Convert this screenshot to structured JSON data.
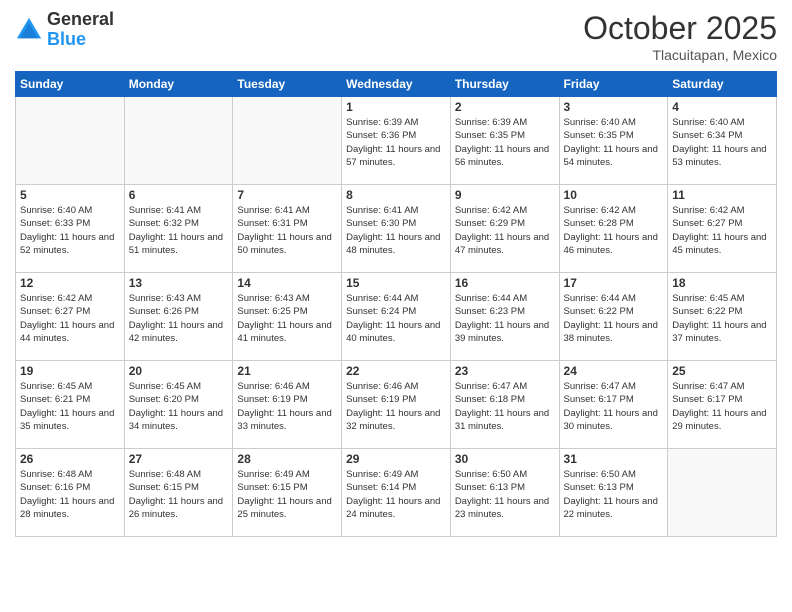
{
  "header": {
    "logo_line1": "General",
    "logo_line2": "Blue",
    "month": "October 2025",
    "location": "Tlacuitapan, Mexico"
  },
  "days_of_week": [
    "Sunday",
    "Monday",
    "Tuesday",
    "Wednesday",
    "Thursday",
    "Friday",
    "Saturday"
  ],
  "weeks": [
    [
      {
        "day": "",
        "empty": true
      },
      {
        "day": "",
        "empty": true
      },
      {
        "day": "",
        "empty": true
      },
      {
        "day": "1",
        "sunrise": "6:39 AM",
        "sunset": "6:36 PM",
        "daylight": "11 hours and 57 minutes."
      },
      {
        "day": "2",
        "sunrise": "6:39 AM",
        "sunset": "6:35 PM",
        "daylight": "11 hours and 56 minutes."
      },
      {
        "day": "3",
        "sunrise": "6:40 AM",
        "sunset": "6:35 PM",
        "daylight": "11 hours and 54 minutes."
      },
      {
        "day": "4",
        "sunrise": "6:40 AM",
        "sunset": "6:34 PM",
        "daylight": "11 hours and 53 minutes."
      }
    ],
    [
      {
        "day": "5",
        "sunrise": "6:40 AM",
        "sunset": "6:33 PM",
        "daylight": "11 hours and 52 minutes."
      },
      {
        "day": "6",
        "sunrise": "6:41 AM",
        "sunset": "6:32 PM",
        "daylight": "11 hours and 51 minutes."
      },
      {
        "day": "7",
        "sunrise": "6:41 AM",
        "sunset": "6:31 PM",
        "daylight": "11 hours and 50 minutes."
      },
      {
        "day": "8",
        "sunrise": "6:41 AM",
        "sunset": "6:30 PM",
        "daylight": "11 hours and 48 minutes."
      },
      {
        "day": "9",
        "sunrise": "6:42 AM",
        "sunset": "6:29 PM",
        "daylight": "11 hours and 47 minutes."
      },
      {
        "day": "10",
        "sunrise": "6:42 AM",
        "sunset": "6:28 PM",
        "daylight": "11 hours and 46 minutes."
      },
      {
        "day": "11",
        "sunrise": "6:42 AM",
        "sunset": "6:27 PM",
        "daylight": "11 hours and 45 minutes."
      }
    ],
    [
      {
        "day": "12",
        "sunrise": "6:42 AM",
        "sunset": "6:27 PM",
        "daylight": "11 hours and 44 minutes."
      },
      {
        "day": "13",
        "sunrise": "6:43 AM",
        "sunset": "6:26 PM",
        "daylight": "11 hours and 42 minutes."
      },
      {
        "day": "14",
        "sunrise": "6:43 AM",
        "sunset": "6:25 PM",
        "daylight": "11 hours and 41 minutes."
      },
      {
        "day": "15",
        "sunrise": "6:44 AM",
        "sunset": "6:24 PM",
        "daylight": "11 hours and 40 minutes."
      },
      {
        "day": "16",
        "sunrise": "6:44 AM",
        "sunset": "6:23 PM",
        "daylight": "11 hours and 39 minutes."
      },
      {
        "day": "17",
        "sunrise": "6:44 AM",
        "sunset": "6:22 PM",
        "daylight": "11 hours and 38 minutes."
      },
      {
        "day": "18",
        "sunrise": "6:45 AM",
        "sunset": "6:22 PM",
        "daylight": "11 hours and 37 minutes."
      }
    ],
    [
      {
        "day": "19",
        "sunrise": "6:45 AM",
        "sunset": "6:21 PM",
        "daylight": "11 hours and 35 minutes."
      },
      {
        "day": "20",
        "sunrise": "6:45 AM",
        "sunset": "6:20 PM",
        "daylight": "11 hours and 34 minutes."
      },
      {
        "day": "21",
        "sunrise": "6:46 AM",
        "sunset": "6:19 PM",
        "daylight": "11 hours and 33 minutes."
      },
      {
        "day": "22",
        "sunrise": "6:46 AM",
        "sunset": "6:19 PM",
        "daylight": "11 hours and 32 minutes."
      },
      {
        "day": "23",
        "sunrise": "6:47 AM",
        "sunset": "6:18 PM",
        "daylight": "11 hours and 31 minutes."
      },
      {
        "day": "24",
        "sunrise": "6:47 AM",
        "sunset": "6:17 PM",
        "daylight": "11 hours and 30 minutes."
      },
      {
        "day": "25",
        "sunrise": "6:47 AM",
        "sunset": "6:17 PM",
        "daylight": "11 hours and 29 minutes."
      }
    ],
    [
      {
        "day": "26",
        "sunrise": "6:48 AM",
        "sunset": "6:16 PM",
        "daylight": "11 hours and 28 minutes."
      },
      {
        "day": "27",
        "sunrise": "6:48 AM",
        "sunset": "6:15 PM",
        "daylight": "11 hours and 26 minutes."
      },
      {
        "day": "28",
        "sunrise": "6:49 AM",
        "sunset": "6:15 PM",
        "daylight": "11 hours and 25 minutes."
      },
      {
        "day": "29",
        "sunrise": "6:49 AM",
        "sunset": "6:14 PM",
        "daylight": "11 hours and 24 minutes."
      },
      {
        "day": "30",
        "sunrise": "6:50 AM",
        "sunset": "6:13 PM",
        "daylight": "11 hours and 23 minutes."
      },
      {
        "day": "31",
        "sunrise": "6:50 AM",
        "sunset": "6:13 PM",
        "daylight": "11 hours and 22 minutes."
      },
      {
        "day": "",
        "empty": true
      }
    ]
  ],
  "labels": {
    "sunrise_prefix": "Sunrise: ",
    "sunset_prefix": "Sunset: ",
    "daylight_prefix": "Daylight: "
  }
}
